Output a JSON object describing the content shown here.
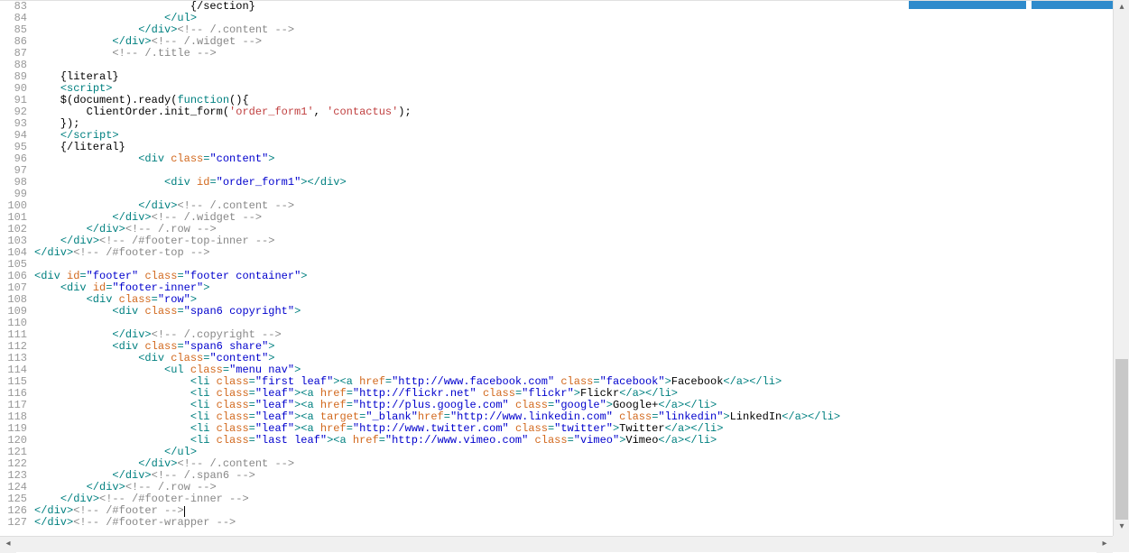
{
  "lineStart": 83,
  "lineEnd": 127,
  "code": {
    "l83": "                        {/section}",
    "l84_close_ul": "ul",
    "l85_close_div": "div",
    "l85_comment": " /.content ",
    "l86_close_div": "div",
    "l86_comment": " /.widget ",
    "l87_comment": " /.title ",
    "l89": "    {literal}",
    "l90_open": "script",
    "l91_pre": "    $(document).ready(",
    "l91_fn": "function",
    "l91_post": "(){",
    "l92_pre": "        ClientOrder.init_form(",
    "l92_s1": "'order_form1'",
    "l92_mid": ", ",
    "l92_s2": "'contactus'",
    "l92_post": ");",
    "l93": "    });",
    "l94_close": "script",
    "l95": "    {/literal}",
    "l96_tag": "div",
    "l96_attr": "class",
    "l96_val": "\"content\"",
    "l98_tag": "div",
    "l98_attr": "id",
    "l98_val": "\"order_form1\"",
    "l100_tag": "div",
    "l100_comment": " /.content ",
    "l101_tag": "div",
    "l101_comment": " /.widget ",
    "l102_tag": "div",
    "l102_comment": " /.row ",
    "l103_tag": "div",
    "l103_comment": " /#footer-top-inner ",
    "l104_tag": "div",
    "l104_comment": " /#footer-top ",
    "l106_tag": "div",
    "l106_a1": "id",
    "l106_v1": "\"footer\"",
    "l106_a2": "class",
    "l106_v2": "\"footer container\"",
    "l107_tag": "div",
    "l107_a1": "id",
    "l107_v1": "\"footer-inner\"",
    "l108_tag": "div",
    "l108_a1": "class",
    "l108_v1": "\"row\"",
    "l109_tag": "div",
    "l109_a1": "class",
    "l109_v1": "\"span6 copyright\"",
    "l111_tag": "div",
    "l111_comment": " /.copyright ",
    "l112_tag": "div",
    "l112_a1": "class",
    "l112_v1": "\"span6 share\"",
    "l113_tag": "div",
    "l113_a1": "class",
    "l113_v1": "\"content\"",
    "l114_tag": "ul",
    "l114_a1": "class",
    "l114_v1": "\"menu nav\"",
    "l115_li": "li",
    "l115_cls": "\"first leaf\"",
    "l115_a": "a",
    "l115_href_a": "href",
    "l115_href": "\"http://www.facebook.com\"",
    "l115_cls_a": "class",
    "l115_clsv": "\"facebook\"",
    "l115_txt": "Facebook",
    "l116_cls": "\"leaf\"",
    "l116_href": "\"http://flickr.net\"",
    "l116_clsv": "\"flickr\"",
    "l116_txt": "Flickr",
    "l117_href": "\"http://plus.google.com\"",
    "l117_clsv": "\"google\"",
    "l117_txt": "Google+",
    "l118_tgt_a": "target",
    "l118_tgt": "\"_blank\"",
    "l118_href": "\"http://www.linkedin.com\"",
    "l118_clsv": "\"linkedin\"",
    "l118_txt": "LinkedIn",
    "l119_href": "\"http://www.twitter.com\"",
    "l119_clsv": "\"twitter\"",
    "l119_txt": "Twitter",
    "l120_cls": "\"last leaf\"",
    "l120_href": "\"http://www.vimeo.com\"",
    "l120_clsv": "\"vimeo\"",
    "l120_txt": "Vimeo",
    "l121_tag": "ul",
    "l122_tag": "div",
    "l122_comment": " /.content ",
    "l123_tag": "div",
    "l123_comment": " /.span6 ",
    "l124_tag": "div",
    "l124_comment": " /.row ",
    "l125_tag": "div",
    "l125_comment": " /#footer-inner ",
    "l126_tag": "div",
    "l126_comment": " /#footer ",
    "l127_tag": "div",
    "l127_comment": " /#footer-wrapper "
  }
}
